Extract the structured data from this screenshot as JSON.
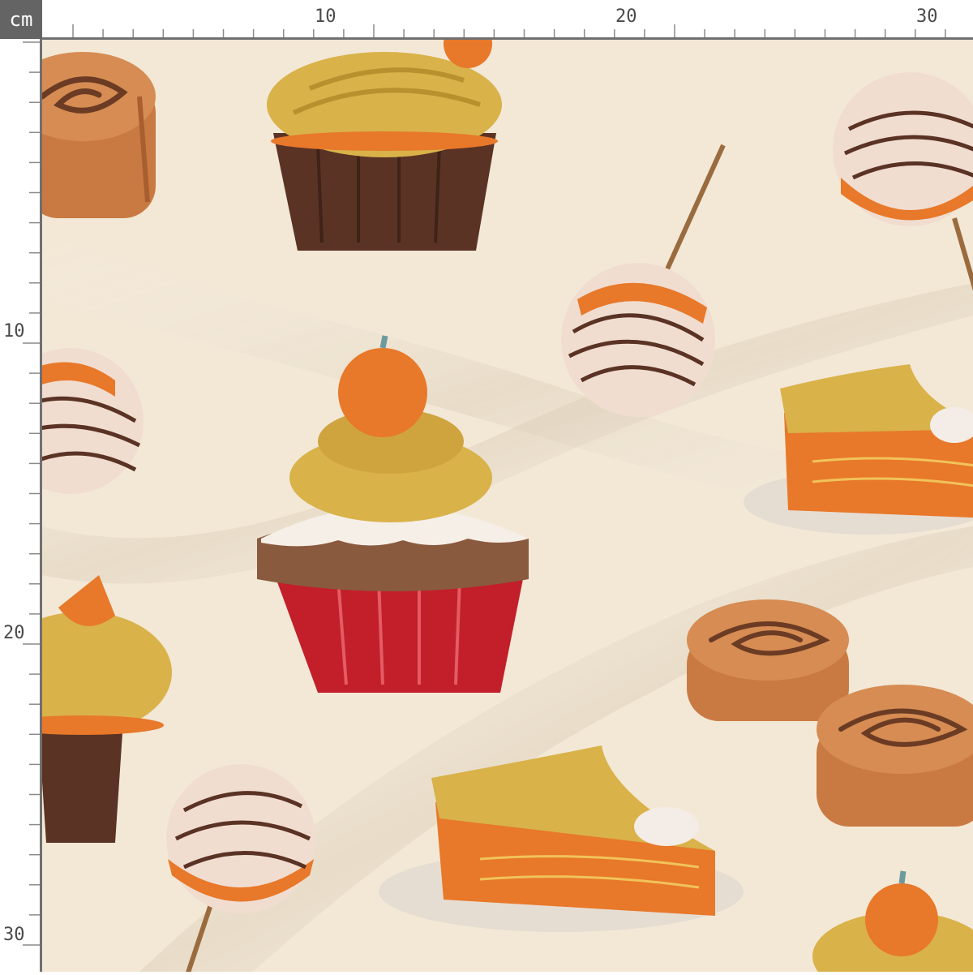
{
  "ruler": {
    "unit": "cm",
    "top_labels": [
      "10",
      "20",
      "30"
    ],
    "left_labels": [
      "10",
      "20",
      "30"
    ]
  },
  "colors": {
    "fabric": "#f3e8d6",
    "ruler_badge": "#646464",
    "chocolate": "#5a3324",
    "pumpkin": "#e8782a",
    "frosting_mustard": "#d9b24a",
    "red_liner": "#c21f2a",
    "cinnamon": "#c97a43"
  },
  "pattern": {
    "motifs": [
      "cupcake-icon",
      "cake-pop-icon",
      "pumpkin-pie-slice-icon",
      "cinnamon-roll-icon",
      "pumpkin-icon",
      "autumn-leaf-icon"
    ]
  }
}
